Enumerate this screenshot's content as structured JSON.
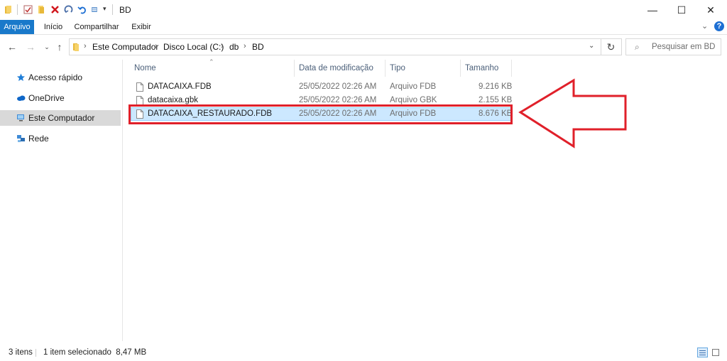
{
  "window": {
    "title": "BD"
  },
  "ribbon": {
    "tabs": [
      "Arquivo",
      "Início",
      "Compartilhar",
      "Exibir"
    ]
  },
  "address": {
    "crumbs": [
      "Este Computador",
      "Disco Local (C:)",
      "db",
      "BD"
    ]
  },
  "search": {
    "placeholder": "Pesquisar em BD"
  },
  "nav": {
    "items": [
      "Acesso rápido",
      "OneDrive",
      "Este Computador",
      "Rede"
    ]
  },
  "columns": [
    "Nome",
    "Data de modificação",
    "Tipo",
    "Tamanho"
  ],
  "files": [
    {
      "name": "DATACAIXA.FDB",
      "date": "25/05/2022 02:26 AM",
      "type": "Arquivo FDB",
      "size": "9.216 KB"
    },
    {
      "name": "datacaixa.gbk",
      "date": "25/05/2022 02:26 AM",
      "type": "Arquivo GBK",
      "size": "2.155 KB"
    },
    {
      "name": "DATACAIXA_RESTAURADO.FDB",
      "date": "25/05/2022 02:26 AM",
      "type": "Arquivo FDB",
      "size": "8.676 KB"
    }
  ],
  "status": {
    "count": "3 itens",
    "selection": "1 item selecionado  8,47 MB"
  },
  "colors": {
    "accent": "#1979ca",
    "selection": "#cce8ff",
    "annotation": "#e0202a"
  }
}
